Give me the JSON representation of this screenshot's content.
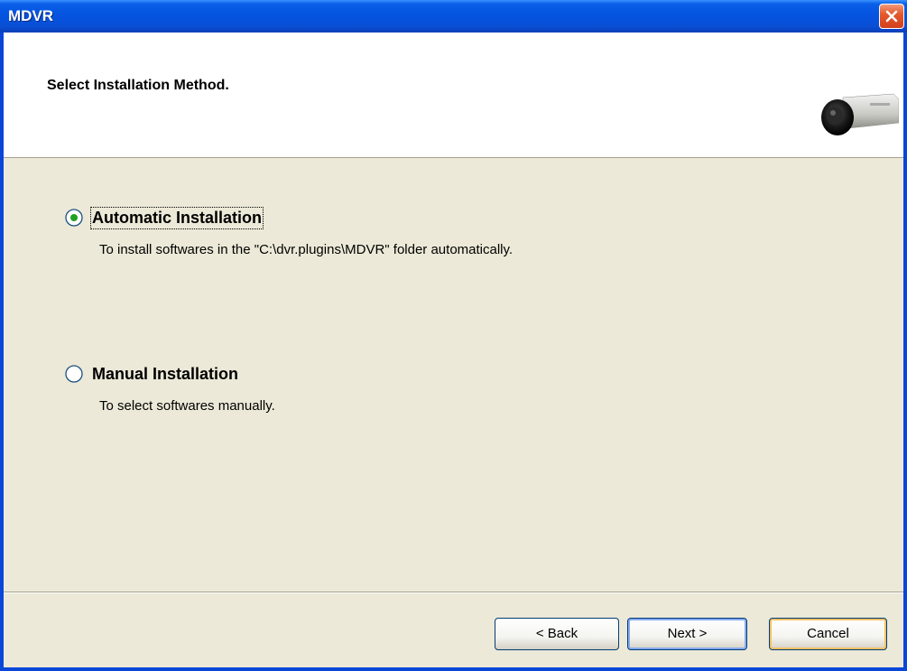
{
  "window": {
    "title": "MDVR",
    "close_icon": "close-icon"
  },
  "header": {
    "title": "Select Installation Method.",
    "icon": "camera-icon"
  },
  "options": [
    {
      "label": "Automatic Installation",
      "description": "To install softwares in the \"C:\\dvr.plugins\\MDVR\" folder automatically.",
      "selected": true
    },
    {
      "label": "Manual Installation",
      "description": "To select softwares manually.",
      "selected": false
    }
  ],
  "buttons": {
    "back": "< Back",
    "next": "Next >",
    "cancel": "Cancel"
  },
  "colors": {
    "titlebar": "#0454E0",
    "dialog_bg": "#ECE9D8",
    "radio_dot": "#21A121"
  }
}
